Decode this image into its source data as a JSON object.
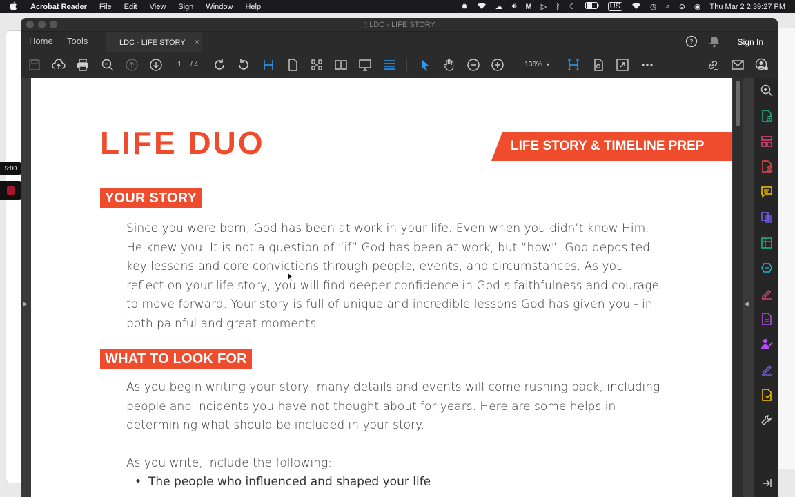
{
  "menubar": {
    "app_name": "Acrobat Reader",
    "menus": [
      "File",
      "Edit",
      "View",
      "Sign",
      "Window",
      "Help"
    ],
    "input_badge": "US",
    "clock": "Thu Mar 2  2:39:27 PM"
  },
  "desktop": {
    "timer": "5:00"
  },
  "window": {
    "title": "LDC - LIFE STORY"
  },
  "tabs": {
    "home": "Home",
    "tools": "Tools",
    "document": "LDC - LIFE STORY",
    "close": "×",
    "sign_in": "Sign In"
  },
  "toolbar": {
    "page_current": "1",
    "page_total": "/ 4",
    "zoom": "136%"
  },
  "document": {
    "logo": "LIFE DUO",
    "banner": "LIFE STORY & TIMELINE PREP",
    "section1_title": "YOUR STORY",
    "section1_body": "Since you were born, God has been at work in your life. Even when you didn’t know Him, He knew you. It is not a question of “if” God has been at work, but “how”. God deposited key lessons and core convictions through people, events, and circumstances. As you reflect on your life story, you will find deeper confidence in God’s faithfulness and courage to move forward. Your story is full of unique and incredible lessons God has given you - in both painful and great moments.",
    "section2_title": "WHAT TO LOOK FOR",
    "section2_body": "As you begin writing your story, many details and events will come rushing back, including people and incidents you have not thought about for years. Here are some helps in determining what should be included in your story.",
    "section2_intro": "As you write, include the following:",
    "bullets": [
      "The people who influenced and shaped your life"
    ]
  },
  "colors": {
    "brand": "#ee4c2c",
    "toolbar_bg": "#2b2b2b",
    "accent_blue": "#2d9cf5"
  }
}
